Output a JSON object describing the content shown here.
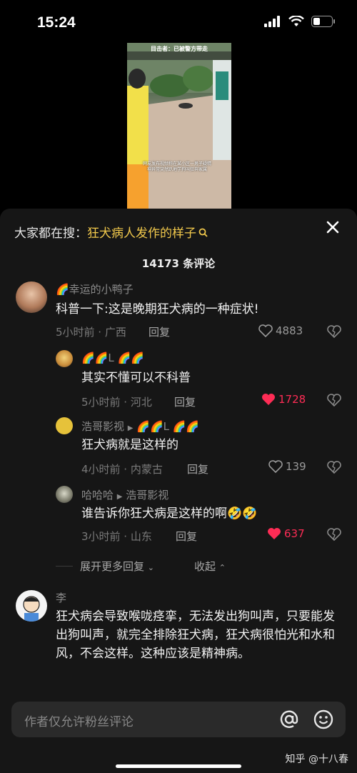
{
  "status": {
    "time": "15:24"
  },
  "video": {
    "caption_top": "目击者：已被警方带走",
    "caption_bottom": "网友发布视频称在某小区一男子疑精神异常突然趴地学狗叫狂奔家属"
  },
  "search": {
    "prefix": "大家都在搜：",
    "term": "狂犬病人发作的样子"
  },
  "comment_count": "14173 条评论",
  "comments": [
    {
      "user": "🌈幸运的小鸭子",
      "text": "科普一下:这是晚期狂犬病的一种症状!",
      "meta": "5小时前 · 广西",
      "reply": "回复",
      "likes": "4883",
      "liked": false
    },
    {
      "user": "🌈🌈L 🌈🌈",
      "text": "其实不懂可以不科普",
      "meta": "5小时前 · 河北",
      "reply": "回复",
      "likes": "1728",
      "liked": true
    },
    {
      "user": "浩哥影视",
      "reply_to": "🌈🌈L 🌈🌈",
      "text": "狂犬病就是这样的",
      "meta": "4小时前 · 内蒙古",
      "reply": "回复",
      "likes": "139",
      "liked": false
    },
    {
      "user": "哈哈哈",
      "reply_to": "浩哥影视",
      "text": "谁告诉你狂犬病是这样的啊🤣🤣",
      "meta": "3小时前 · 山东",
      "reply": "回复",
      "likes": "637",
      "liked": true
    },
    {
      "user": "李",
      "text": "狂犬病会导致喉咙痉挛，无法发出狗叫声，只要能发出狗叫声，就完全排除狂犬病，狂犬病很怕光和水和风，不会这样。这种应该是精神病。"
    }
  ],
  "expand": {
    "more": "展开更多回复",
    "collapse": "收起"
  },
  "input": {
    "placeholder": "作者仅允许粉丝评论"
  },
  "watermark": "知乎 @十八春",
  "colors": {
    "accent": "#f2c94c",
    "like_red": "#fe2c55",
    "sheet": "#161616"
  }
}
